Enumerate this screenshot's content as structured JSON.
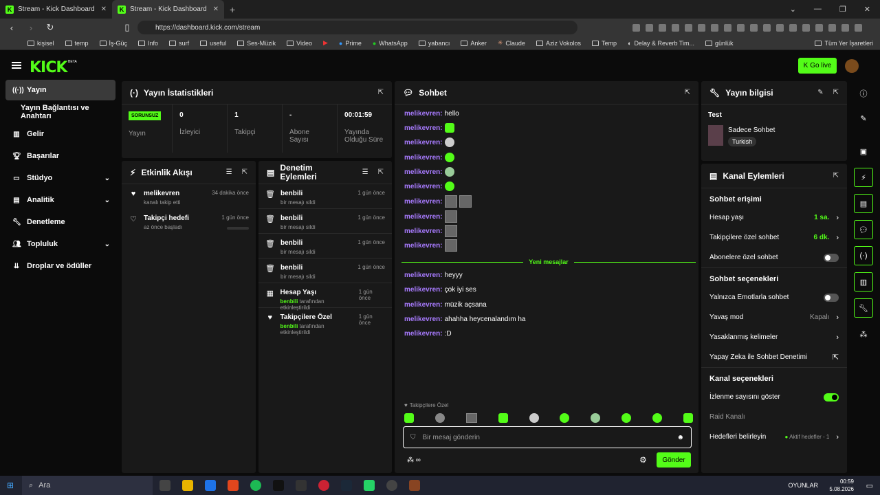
{
  "browser": {
    "tabs": [
      {
        "title": "Stream - Kick Dashboard"
      },
      {
        "title": "Stream - Kick Dashboard"
      }
    ],
    "url": "https://dashboard.kick.com/stream",
    "bookmarks": [
      "kişisel",
      "temp",
      "İş-Güç",
      "Info",
      "surf",
      "useful",
      "Ses-Müzik",
      "Video",
      "Prime",
      "WhatsApp",
      "yabancı",
      "Anker",
      "Claude",
      "Aziz Vokolos",
      "Temp",
      "Delay & Reverb Tim...",
      "günlük"
    ],
    "all_bookmarks": "Tüm Yer İşaretleri"
  },
  "header": {
    "logo": "KICK",
    "beta": "BETA",
    "golive": "Go live"
  },
  "sidebar": {
    "items": [
      {
        "label": "Yayın",
        "icon": "broadcast-icon"
      },
      {
        "label": "Yayın Bağlantısı ve Anahtarı"
      },
      {
        "label": "Gelir",
        "icon": "revenue-icon"
      },
      {
        "label": "Başarılar",
        "icon": "trophy-icon"
      },
      {
        "label": "Stüdyo",
        "icon": "studio-icon"
      },
      {
        "label": "Analitik",
        "icon": "analytics-icon"
      },
      {
        "label": "Denetleme",
        "icon": "wrench-icon"
      },
      {
        "label": "Topluluk",
        "icon": "community-icon"
      },
      {
        "label": "Droplar ve ödüller",
        "icon": "drops-icon"
      }
    ]
  },
  "stats": {
    "title": "Yayın İstatistikleri",
    "badge": "SORUNSUZ",
    "items": [
      {
        "value": "",
        "label": "Yayın"
      },
      {
        "value": "0",
        "label": "İzleyici"
      },
      {
        "value": "1",
        "label": "Takipçi"
      },
      {
        "value": "-",
        "label": "Abone Sayısı"
      },
      {
        "value": "00:01:59",
        "label": "Yayında Olduğu Süre"
      }
    ]
  },
  "activity": {
    "title": "Etkinlik Akışı",
    "items": [
      {
        "title": "melikevren",
        "sub": "kanalı takip etti",
        "time": "34 dakika önce"
      },
      {
        "title": "Takipçi hedefi",
        "sub": "az önce başladı",
        "time": "1 gün önce"
      }
    ]
  },
  "mod": {
    "title": "Denetim Eylemleri",
    "items": [
      {
        "title": "benbili",
        "sub": "bir mesajı sildi",
        "time": "1 gün önce"
      },
      {
        "title": "benbili",
        "sub": "bir mesajı sildi",
        "time": "1 gün önce"
      },
      {
        "title": "benbili",
        "sub": "bir mesajı sildi",
        "time": "1 gün önce"
      },
      {
        "title": "benbili",
        "sub": "bir mesajı sildi",
        "time": "1 gün önce"
      },
      {
        "title": "Hesap Yaşı",
        "actor": "benbili",
        "sub": "tarafından etkinleştirildi",
        "time": "1 gün önce"
      },
      {
        "title": "Takipçilere Özel",
        "actor": "benbili",
        "sub": "tarafından etkinleştirildi",
        "time": "1 gün önce"
      }
    ]
  },
  "chat": {
    "title": "Sohbet",
    "user": "melikevren:",
    "first": "hello",
    "new_messages": "Yeni mesajlar",
    "after": [
      "heyyy",
      "çok iyi ses",
      "müzik açsana",
      "ahahha heycenalandım ha",
      ":D"
    ],
    "followers_only": "Takipçilere Özel",
    "placeholder": "Bir mesaj gönderin",
    "send": "Gönder"
  },
  "info": {
    "title": "Yayın bilgisi",
    "stream_title": "Test",
    "category": "Sadece Sohbet",
    "tag": "Turkish"
  },
  "actions": {
    "title": "Kanal Eylemleri",
    "chat_access": "Sohbet erişimi",
    "account_age": "Hesap yaşı",
    "account_age_val": "1 sa.",
    "followers_chat": "Takipçilere özel sohbet",
    "followers_val": "6 dk.",
    "subs_chat": "Abonelere özel sohbet",
    "chat_options": "Sohbet seçenekleri",
    "emote_only": "Yalnızca Emotlarla sohbet",
    "slow_mode": "Yavaş mod",
    "slow_val": "Kapalı",
    "banned_words": "Yasaklanmış kelimeler",
    "ai_mod": "Yapay Zeka ile Sohbet Denetimi",
    "channel_options": "Kanal seçenekleri",
    "show_viewers": "İzlenme sayısını göster",
    "raid": "Raid Kanalı",
    "goals": "Hedefleri belirleyin",
    "goals_val": "Aktif hedefler - 1"
  },
  "taskbar": {
    "search": "Ara",
    "games": "OYUNLAR",
    "time": "00:59",
    "date": "5.08.2026"
  }
}
